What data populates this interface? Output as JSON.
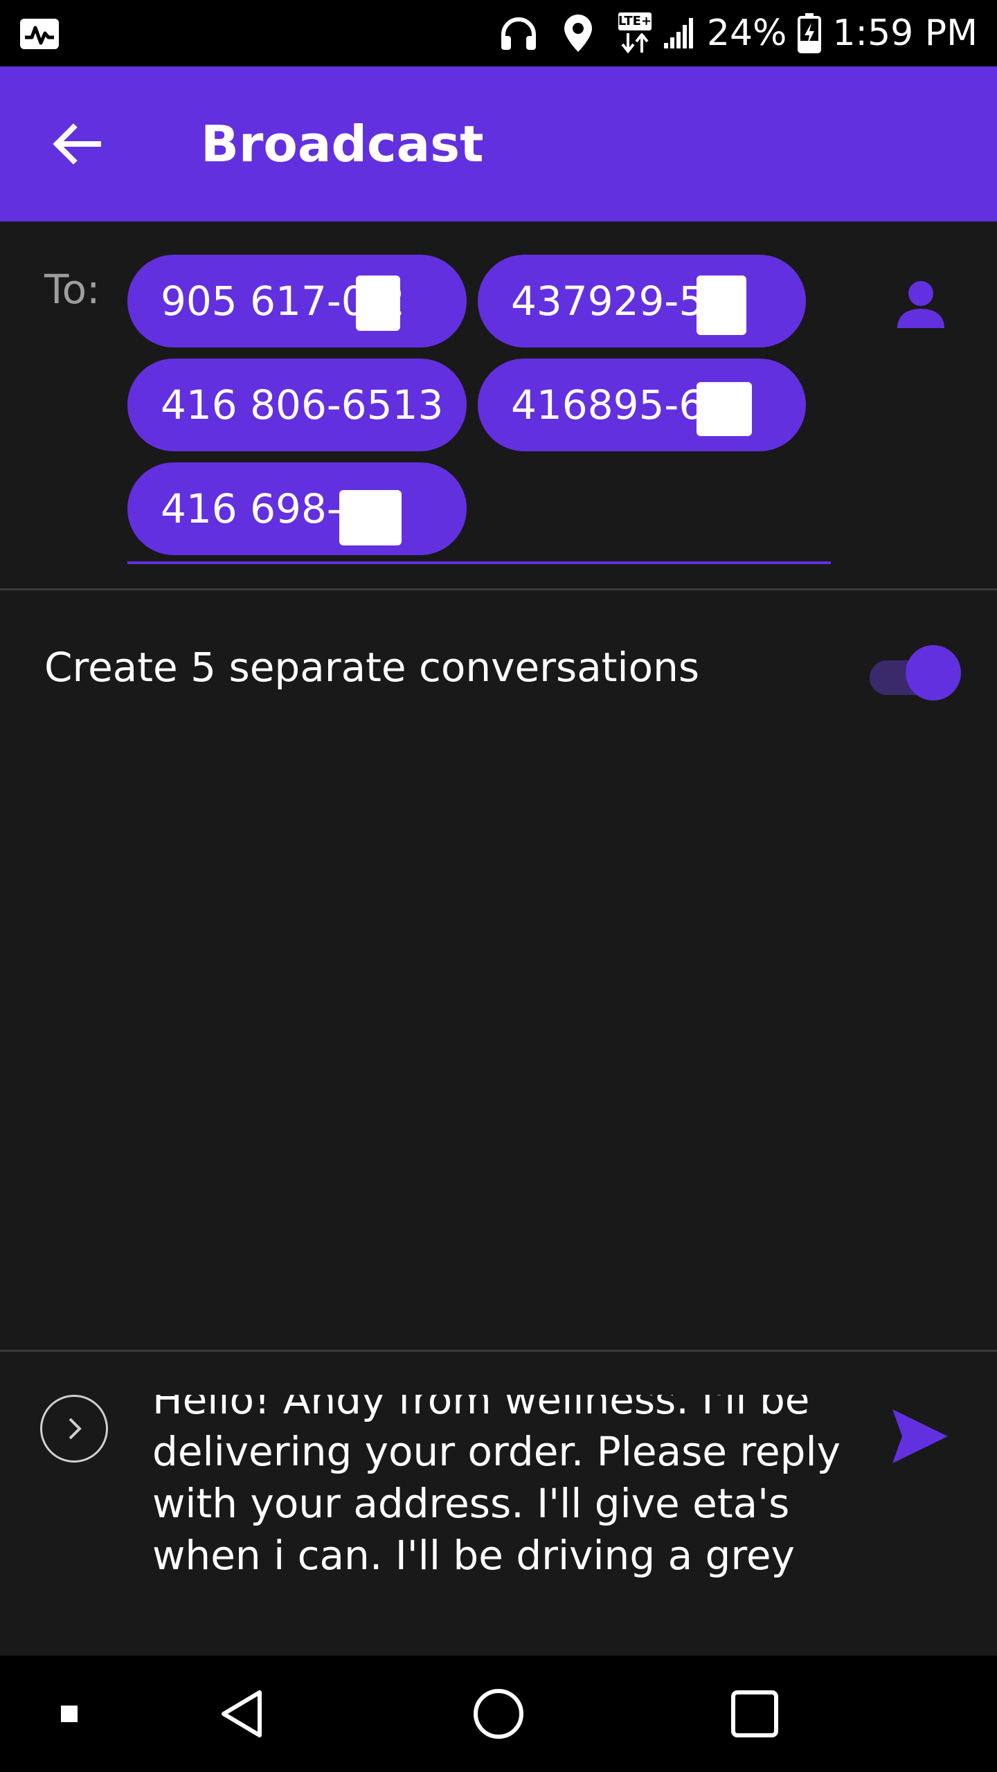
{
  "status_bar": {
    "battery": "24%",
    "time": "1:59 PM",
    "network_badge": "LTE+",
    "icons": [
      "activity-monitor-icon",
      "headphones-icon",
      "location-icon",
      "lte-icon",
      "signal-icon",
      "battery-charging-icon"
    ]
  },
  "app_bar": {
    "title": "Broadcast",
    "back_icon": "arrow-left-icon",
    "color": "#6330df"
  },
  "recipients": {
    "label": "To:",
    "chips": [
      "905 617-0 2",
      "437929-5 1",
      "416 806-6513",
      "416895-6 4",
      "416 698-7 1"
    ],
    "contact_icon": "person-icon"
  },
  "option": {
    "label": "Create 5 separate conversations",
    "toggle_on": true
  },
  "compose": {
    "message": "Hello! Andy from wellness. I'll be delivering your order. Please reply with your address. I'll give eta's when i can. I'll be driving a grey toyota car. Thanks!!",
    "expand_icon": "chevron-right-icon",
    "send_icon": "send-icon"
  },
  "nav_bar": {
    "icons": [
      "square-small-icon",
      "back-triangle-icon",
      "home-circle-icon",
      "recents-square-icon"
    ]
  }
}
